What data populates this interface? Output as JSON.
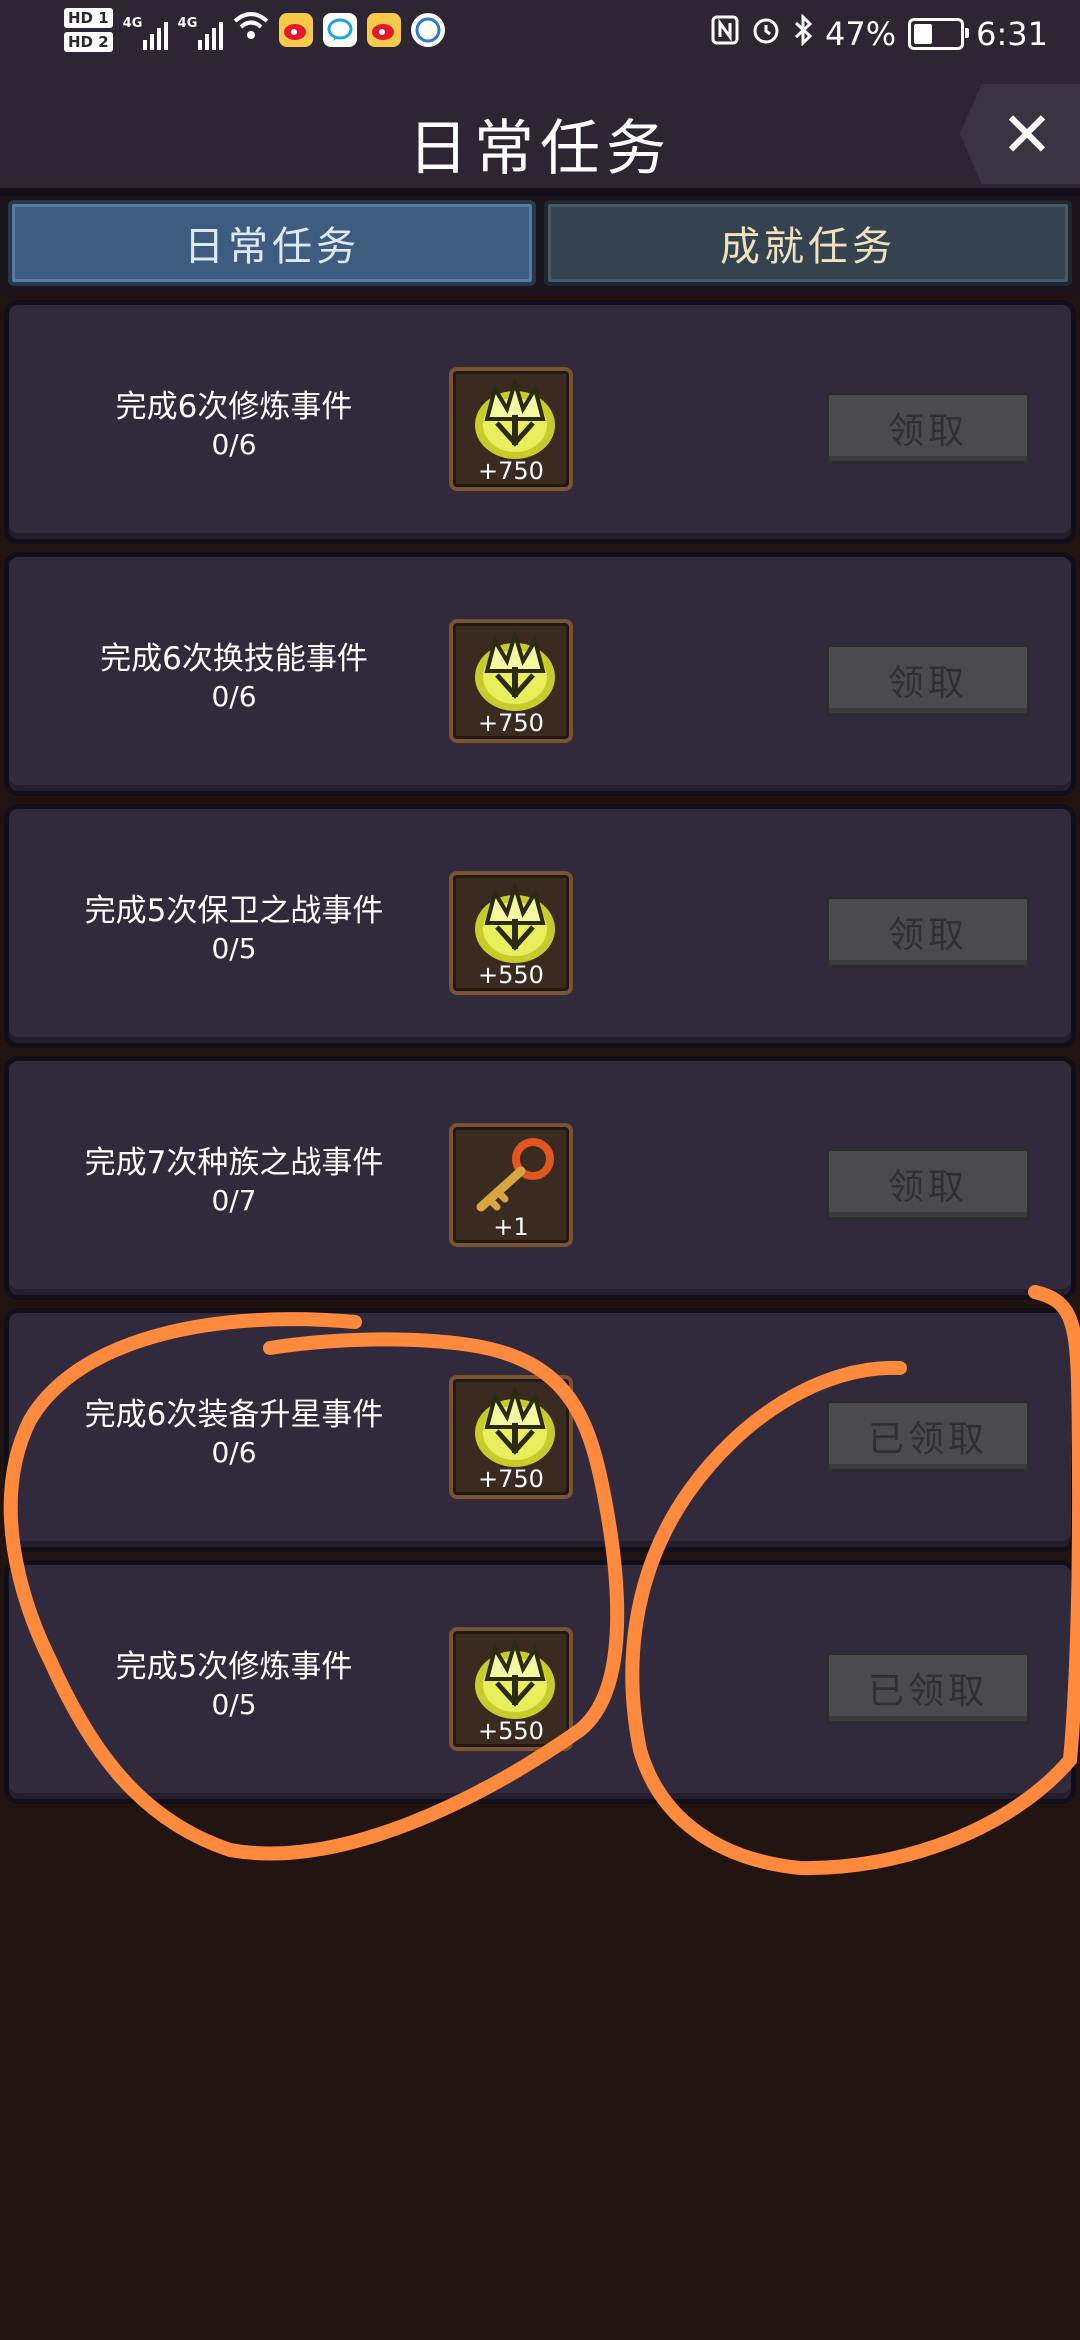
{
  "status_bar": {
    "hd1": "HD 1",
    "hd2": "HD 2",
    "net1": "4G",
    "net2": "4G",
    "battery_percent": "47%",
    "battery_level": 0.47,
    "time": "6:31",
    "icons": [
      "wifi-icon",
      "weibo-icon",
      "chat-bubble-icon",
      "weibo-icon",
      "ifly-icon",
      "nfc-icon",
      "alarm-icon",
      "bluetooth-icon"
    ]
  },
  "header": {
    "title": "日常任务",
    "close_glyph": "✕"
  },
  "tabs": [
    {
      "label": "日常任务",
      "active": true
    },
    {
      "label": "成就任务",
      "active": false
    }
  ],
  "tasks": [
    {
      "title": "完成6次修炼事件",
      "progress": "0/6",
      "reward_icon": "crown-coin-icon",
      "reward_qty": "+750",
      "button": "领取"
    },
    {
      "title": "完成6次换技能事件",
      "progress": "0/6",
      "reward_icon": "crown-coin-icon",
      "reward_qty": "+750",
      "button": "领取"
    },
    {
      "title": "完成5次保卫之战事件",
      "progress": "0/5",
      "reward_icon": "crown-coin-icon",
      "reward_qty": "+550",
      "button": "领取"
    },
    {
      "title": "完成7次种族之战事件",
      "progress": "0/7",
      "reward_icon": "key-icon",
      "reward_qty": "+1",
      "button": "领取"
    },
    {
      "title": "完成6次装备升星事件",
      "progress": "0/6",
      "reward_icon": "crown-coin-icon",
      "reward_qty": "+750",
      "button": "已领取"
    },
    {
      "title": "完成5次修炼事件",
      "progress": "0/5",
      "reward_icon": "crown-coin-icon",
      "reward_qty": "+550",
      "button": "已领取"
    }
  ],
  "colors": {
    "annotation_stroke": "#ff8a3d",
    "active_tab": "#3d5c80",
    "row_bg": "#312a3d"
  }
}
